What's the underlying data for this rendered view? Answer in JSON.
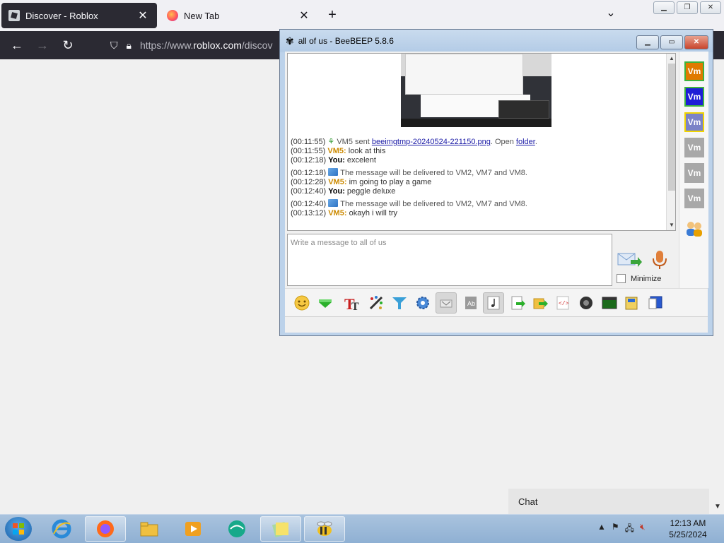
{
  "browser": {
    "tabs": [
      {
        "title": "Discover - Roblox",
        "active": true
      },
      {
        "title": "New Tab",
        "active": false
      }
    ],
    "url_prefix": "https://www.",
    "url_domain": "roblox.com",
    "url_rest": "/discov",
    "close_glyph": "✕",
    "new_tab_glyph": "+",
    "tab_list_glyph": "⌄"
  },
  "chat_widget": {
    "label": "Chat"
  },
  "beebeep": {
    "title": "all of us - BeeBEEP 5.8.6",
    "messages": [
      {
        "ts": "(00:11:55)",
        "icon": "download-plant-icon",
        "pre": "VM5 sent ",
        "link1": "beeimgtmp-20240524-221150.png",
        "mid": ". Open ",
        "link2": "folder",
        "post": "."
      },
      {
        "ts": "(00:11:55)",
        "who": "VM5",
        "text": "look at this"
      },
      {
        "ts": "(00:12:18)",
        "who": "You",
        "text": "excelent"
      },
      {
        "ts": "(00:12:18)",
        "icon": "envelope-icon",
        "sys": "The message will be delivered to VM2, VM7 and VM8."
      },
      {
        "ts": "(00:12:28)",
        "who": "VM5",
        "text": "im going to play a game"
      },
      {
        "ts": "(00:12:40)",
        "who": "You",
        "text": "peggle deluxe"
      },
      {
        "ts": "(00:12:40)",
        "icon": "envelope-icon",
        "sys": "The message will be delivered to VM2, VM7 and VM8."
      },
      {
        "ts": "(00:13:12)",
        "who": "VM5",
        "text": "okayh i will try"
      }
    ],
    "input_placeholder": "Write a message to all of us",
    "minimize_label": "Minimize",
    "users": [
      {
        "label": "Vm",
        "color": "#e07a00",
        "border": "#3db33d"
      },
      {
        "label": "Vm",
        "color": "#1d1dd6",
        "border": "#3db33d"
      },
      {
        "label": "Vm",
        "color": "#7b83c7",
        "border": "#f0d400"
      },
      {
        "label": "Vm",
        "color": "#a8a8a8",
        "border": "#a8a8a8"
      },
      {
        "label": "Vm",
        "color": "#a8a8a8",
        "border": "#a8a8a8"
      },
      {
        "label": "Vm",
        "color": "#a8a8a8",
        "border": "#a8a8a8"
      }
    ]
  },
  "taskbar": {
    "time": "12:13 AM",
    "date": "5/25/2024",
    "apps": [
      "internet-explorer-icon",
      "firefox-icon",
      "file-explorer-icon",
      "media-player-icon",
      "green-sphere-icon",
      "sticky-notes-icon",
      "beebeep-icon"
    ]
  }
}
